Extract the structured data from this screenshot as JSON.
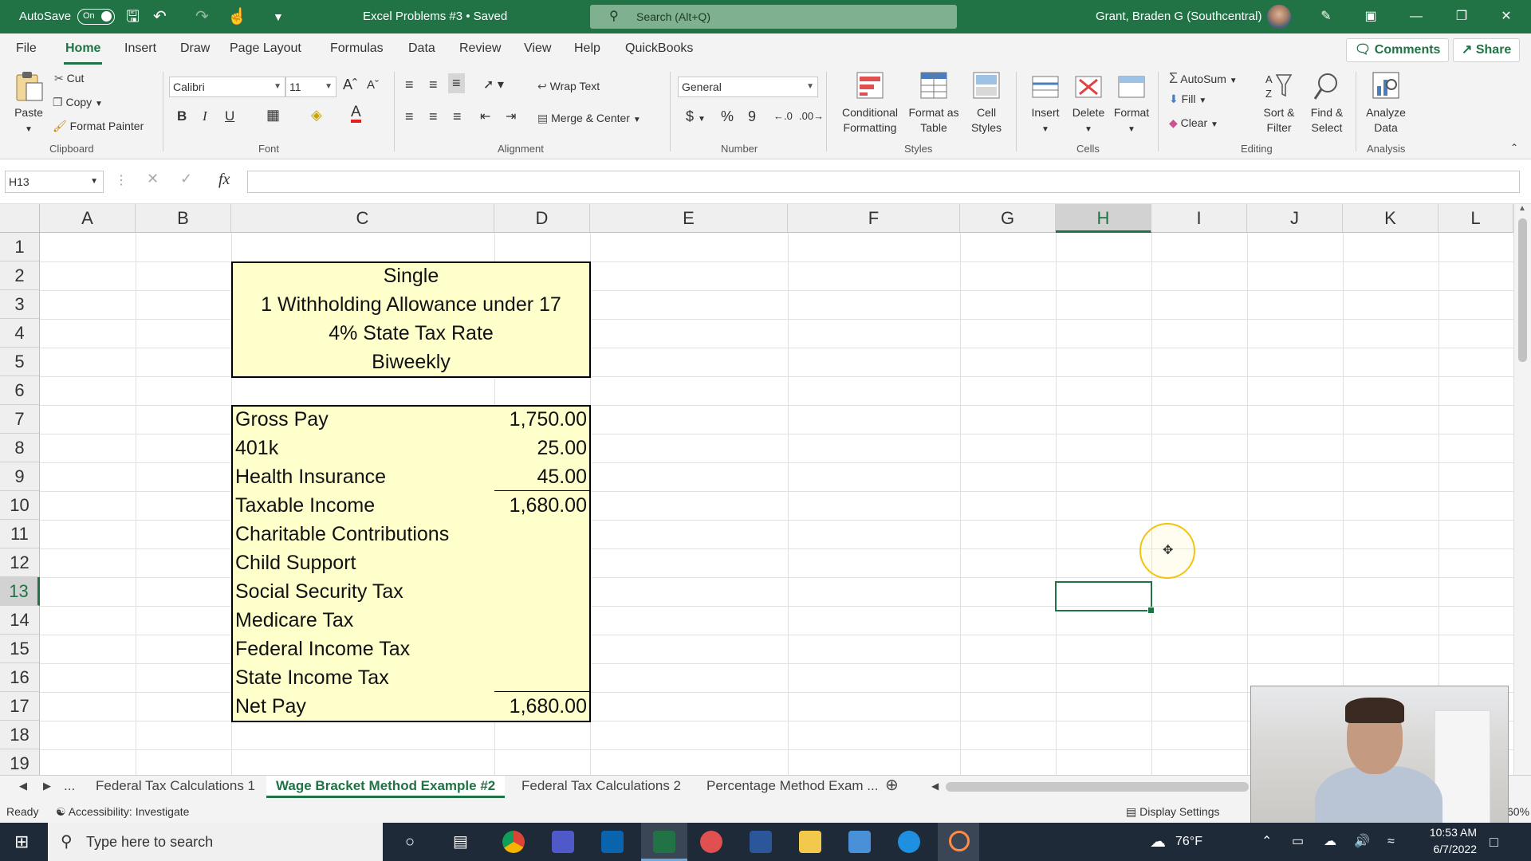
{
  "title_bar": {
    "autosave_label": "AutoSave",
    "autosave_state": "On",
    "document_title": "Excel Problems #3 • Saved",
    "search_placeholder": "Search (Alt+Q)",
    "user_name": "Grant, Braden G (Southcentral)"
  },
  "menu": {
    "items": [
      "File",
      "Home",
      "Insert",
      "Draw",
      "Page Layout",
      "Formulas",
      "Data",
      "Review",
      "View",
      "Help",
      "QuickBooks"
    ],
    "active": "Home",
    "comments_label": "Comments",
    "share_label": "Share"
  },
  "ribbon": {
    "clipboard": {
      "paste": "Paste",
      "cut": "Cut",
      "copy": "Copy",
      "format_painter": "Format Painter",
      "label": "Clipboard"
    },
    "font": {
      "name": "Calibri",
      "size": "11",
      "label": "Font"
    },
    "alignment": {
      "wrap_text": "Wrap Text",
      "merge_center": "Merge & Center",
      "label": "Alignment"
    },
    "number": {
      "format": "General",
      "label": "Number"
    },
    "styles": {
      "conditional": "Conditional Formatting",
      "format_table": "Format as Table",
      "cell_styles": "Cell Styles",
      "label": "Styles"
    },
    "cells": {
      "insert": "Insert",
      "delete": "Delete",
      "format": "Format",
      "label": "Cells"
    },
    "editing": {
      "autosum": "AutoSum",
      "fill": "Fill",
      "clear": "Clear",
      "sort_filter": "Sort & Filter",
      "find_select": "Find & Select",
      "label": "Editing"
    },
    "analysis": {
      "analyze": "Analyze Data",
      "label": "Analysis"
    }
  },
  "formula_bar": {
    "name_box": "H13",
    "fx": "fx",
    "formula": ""
  },
  "columns": [
    "A",
    "B",
    "C",
    "D",
    "E",
    "F",
    "G",
    "H",
    "I",
    "J",
    "K",
    "L"
  ],
  "rows": [
    "1",
    "2",
    "3",
    "4",
    "5",
    "6",
    "7",
    "8",
    "9",
    "10",
    "11",
    "12",
    "13",
    "14",
    "15",
    "16",
    "17",
    "18",
    "19"
  ],
  "selected_cell": {
    "column": "H",
    "row": "13"
  },
  "header_box": {
    "lines": [
      "Single",
      "1 Withholding Allowance under 17",
      "4% State Tax Rate",
      "Biweekly"
    ]
  },
  "table": {
    "rows": [
      {
        "label": "Gross Pay",
        "value": "1,750.00"
      },
      {
        "label": "401k",
        "value": "25.00"
      },
      {
        "label": "Health Insurance",
        "value": "45.00"
      },
      {
        "label": "Taxable Income",
        "value": "1,680.00"
      },
      {
        "label": "Charitable Contributions",
        "value": ""
      },
      {
        "label": "Child Support",
        "value": ""
      },
      {
        "label": "Social Security Tax",
        "value": ""
      },
      {
        "label": "Medicare Tax",
        "value": ""
      },
      {
        "label": "Federal Income Tax",
        "value": ""
      },
      {
        "label": "State Income Tax",
        "value": ""
      },
      {
        "label": "Net Pay",
        "value": "1,680.00"
      }
    ]
  },
  "sheet_tabs": {
    "ellipsis": "...",
    "tabs": [
      "Federal Tax Calculations 1",
      "Wage Bracket Method Example #2",
      "Federal Tax Calculations 2",
      "Percentage Method Exam ..."
    ],
    "active": "Wage Bracket Method Example #2"
  },
  "status_bar": {
    "ready": "Ready",
    "accessibility": "Accessibility: Investigate",
    "display_settings": "Display Settings",
    "zoom": "60%"
  },
  "taskbar": {
    "search_placeholder": "Type here to search",
    "weather": "76°F",
    "time": "10:53 AM",
    "date": "6/7/2022"
  }
}
